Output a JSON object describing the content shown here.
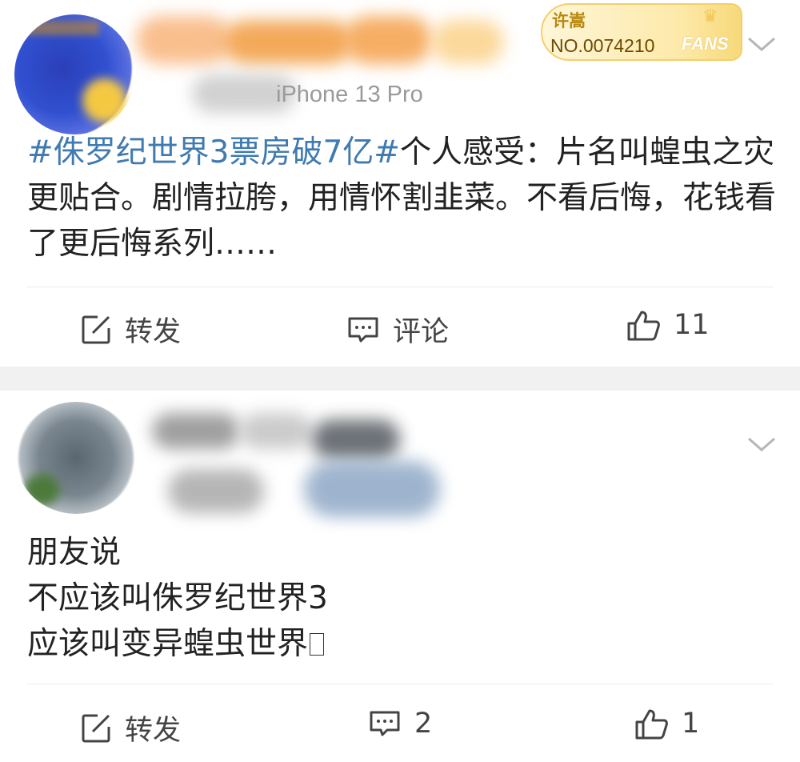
{
  "post1": {
    "device": "iPhone 13 Pro",
    "fans_badge": {
      "name": "许嵩",
      "number": "NO.0074210",
      "label": "FANS"
    },
    "hashtag": "#侏罗纪世界3票房破7亿#",
    "text": "个人感受：片名叫蝗虫之灾更贴合。剧情拉胯，用情怀割韭菜。不看后悔，花钱看了更后悔系列……",
    "actions": {
      "repost": "转发",
      "comment": "评论",
      "like_count": "11"
    }
  },
  "post2": {
    "lines": [
      "朋友说",
      "不应该叫侏罗纪世界3",
      "应该叫变异蝗虫世界"
    ],
    "actions": {
      "repost": "转发",
      "comment_count": "2",
      "like_count": "1"
    }
  },
  "colors": {
    "hashtag": "#3f7ab0",
    "badge_gold": "#f4cf6b",
    "separator": "#f1f1f1"
  },
  "icons": [
    "chevron-down-icon",
    "repost-icon",
    "comment-icon",
    "like-icon"
  ]
}
